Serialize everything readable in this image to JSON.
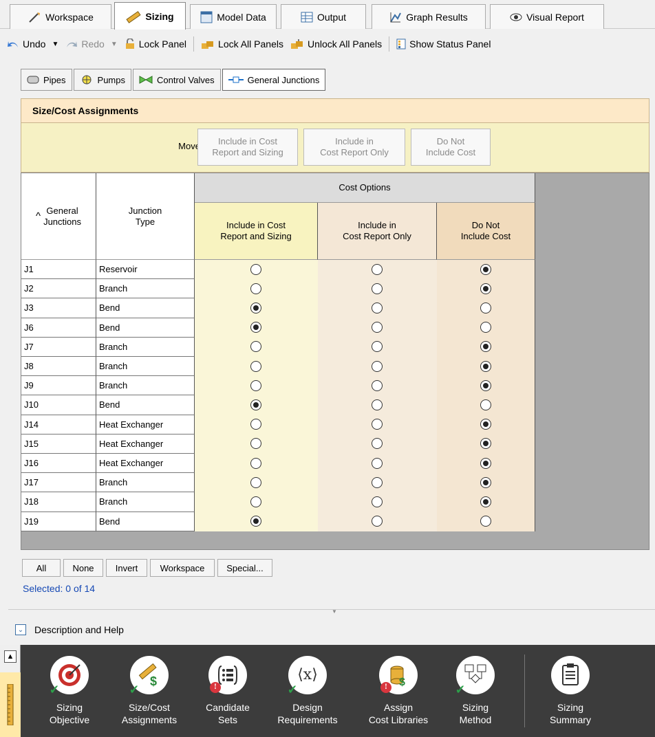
{
  "tabs": [
    {
      "label": "Workspace",
      "icon": "workspace-icon"
    },
    {
      "label": "Sizing",
      "icon": "ruler-icon",
      "active": true
    },
    {
      "label": "Model Data",
      "icon": "model-data-icon"
    },
    {
      "label": "Output",
      "icon": "table-icon"
    },
    {
      "label": "Graph Results",
      "icon": "graph-icon"
    },
    {
      "label": "Visual Report",
      "icon": "eye-icon"
    }
  ],
  "toolbar": {
    "undo": "Undo",
    "redo": "Redo",
    "lock_panel": "Lock Panel",
    "lock_all": "Lock All Panels",
    "unlock_all": "Unlock All Panels",
    "status_panel": "Show Status Panel"
  },
  "subtabs": [
    {
      "label": "Pipes",
      "icon": "pipe-icon"
    },
    {
      "label": "Pumps",
      "icon": "pump-icon"
    },
    {
      "label": "Control Valves",
      "icon": "valve-icon"
    },
    {
      "label": "General Junctions",
      "icon": "junction-icon",
      "active": true
    }
  ],
  "panel": {
    "title": "Size/Cost Assignments",
    "move_to_label": "Move to:",
    "move_buttons": [
      "Include in Cost\nReport and Sizing",
      "Include in\nCost Report Only",
      "Do Not\nInclude Cost"
    ]
  },
  "grid": {
    "col_junctions": "General\nJunctions",
    "col_type": "Junction\nType",
    "group_header": "Cost Options",
    "options": [
      "Include in Cost\nReport and Sizing",
      "Include in\nCost Report Only",
      "Do Not\nInclude Cost"
    ],
    "rows": [
      {
        "id": "J1",
        "type": "Reservoir",
        "sel": 2
      },
      {
        "id": "J2",
        "type": "Branch",
        "sel": 2
      },
      {
        "id": "J3",
        "type": "Bend",
        "sel": 0
      },
      {
        "id": "J6",
        "type": "Bend",
        "sel": 0
      },
      {
        "id": "J7",
        "type": "Branch",
        "sel": 2
      },
      {
        "id": "J8",
        "type": "Branch",
        "sel": 2
      },
      {
        "id": "J9",
        "type": "Branch",
        "sel": 2
      },
      {
        "id": "J10",
        "type": "Bend",
        "sel": 0
      },
      {
        "id": "J14",
        "type": "Heat Exchanger",
        "sel": 2
      },
      {
        "id": "J15",
        "type": "Heat Exchanger",
        "sel": 2
      },
      {
        "id": "J16",
        "type": "Heat Exchanger",
        "sel": 2
      },
      {
        "id": "J17",
        "type": "Branch",
        "sel": 2
      },
      {
        "id": "J18",
        "type": "Branch",
        "sel": 2
      },
      {
        "id": "J19",
        "type": "Bend",
        "sel": 0
      }
    ]
  },
  "buttons": {
    "all": "All",
    "none": "None",
    "invert": "Invert",
    "workspace": "Workspace",
    "special": "Special..."
  },
  "selected_text": "Selected: 0 of 14",
  "description": "Description and Help",
  "dock": [
    {
      "label": "Sizing\nObjective",
      "icon": "target-icon",
      "status": "ok"
    },
    {
      "label": "Size/Cost\nAssignments",
      "icon": "ruler-dollar-icon",
      "status": "ok"
    },
    {
      "label": "Candidate\nSets",
      "icon": "candidate-sets-icon",
      "status": "err"
    },
    {
      "label": "Design\nRequirements",
      "icon": "function-icon",
      "glyph": "⟨x⟩",
      "status": "ok"
    },
    {
      "label": "Assign\nCost Libraries",
      "icon": "cost-library-icon",
      "status": "err"
    },
    {
      "label": "Sizing\nMethod",
      "icon": "flowchart-icon",
      "status": "ok"
    },
    {
      "label": "Sizing\nSummary",
      "icon": "clipboard-icon",
      "status": "none"
    }
  ],
  "colors": {
    "header_bg": "#fde9c8",
    "move_bg": "#f6f1c4",
    "col1_bg": "#faf6d8",
    "col2_bg": "#f5ebdc",
    "col3_bg": "#f4e6d2",
    "selected_link": "#1548b4"
  }
}
